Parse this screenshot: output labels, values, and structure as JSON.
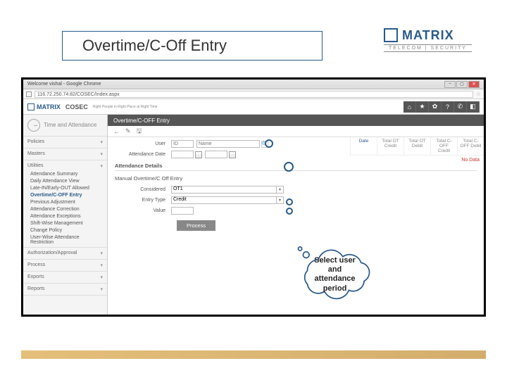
{
  "slide": {
    "title": "Overtime/C-Off Entry"
  },
  "logo": {
    "brand": "MATRIX",
    "sub": "TELECOM | SECURITY"
  },
  "browser": {
    "tab_title": "Welcome vishal - Google Chrome",
    "url": "116.72.250.74:82/COSEC/Index.aspx"
  },
  "app": {
    "brand": "MATRIX",
    "product": "COSEC",
    "tagline": "Right People in Right Place at Right Time"
  },
  "sidebar": {
    "module": "Time and Attendance",
    "sections": [
      {
        "label": "Policies"
      },
      {
        "label": "Masters"
      },
      {
        "label": "Utilities",
        "items": [
          "Attendance Summary",
          "Daily Attendance View",
          "Late-IN/Early-OUT Allowed",
          "Overtime/C-OFF Entry",
          "Previous Adjustment",
          "Attendance Correction",
          "Attendance Exceptions",
          "Shift-Wise Management",
          "Change Policy",
          "User-Wise Attendance Restriction"
        ],
        "active_index": 3
      },
      {
        "label": "Authorization/Approval"
      },
      {
        "label": "Process"
      },
      {
        "label": "Exports"
      },
      {
        "label": "Reports"
      }
    ]
  },
  "content": {
    "header": "Overtime/C-OFF Entry",
    "section_attendance": "Attendance Details",
    "section_manual": "Manual Overtime/C Off Entry",
    "labels": {
      "user": "User",
      "user_id": "ID",
      "user_name": "Name",
      "attendance_date": "Attendance Date",
      "considered": "Considered",
      "entry_type": "Entry Type",
      "value": "Value"
    },
    "values": {
      "considered": "OT1",
      "entry_type": "Credit"
    },
    "process_btn": "Process"
  },
  "totals": {
    "date_label": "Date",
    "cols": [
      "Total OT Credit",
      "Total OT Debit",
      "Total C-OFF Credit",
      "Total C-OFF Debit"
    ],
    "no_data": "No Data"
  },
  "callout": {
    "text1": "Select user",
    "text2": "and",
    "text3": "attendance",
    "text4": "period"
  }
}
